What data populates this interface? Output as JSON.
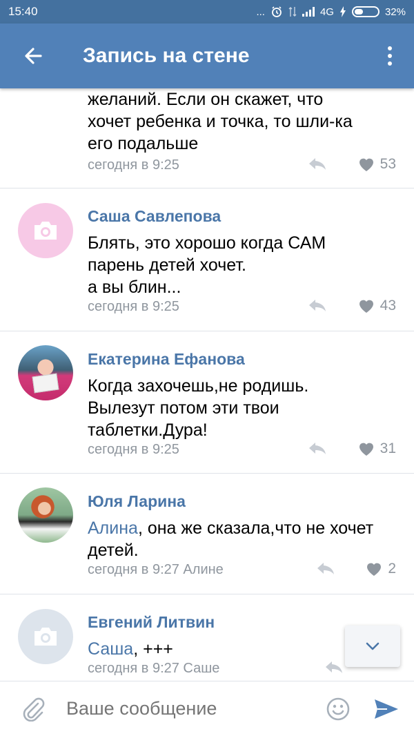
{
  "status_bar": {
    "time": "15:40",
    "dots": "...",
    "network": "4G",
    "battery": "32%"
  },
  "app_bar": {
    "title": "Запись на стене"
  },
  "comments": [
    {
      "name": "",
      "text_lines": [
        "желаний. Если он скажет, что",
        "хочет ребенка и точка, то шли-ка",
        "его подальше"
      ],
      "time": "сегодня в 9:25",
      "likes": "53"
    },
    {
      "name": "Саша Савлепова",
      "text_lines": [
        "Блять, это хорошо когда САМ",
        "парень детей хочет.",
        "а вы блин..."
      ],
      "time": "сегодня в 9:25",
      "likes": "43"
    },
    {
      "name": "Екатерина Ефанова",
      "text_lines": [
        "Когда захочешь,не родишь.",
        "Вылезут потом эти твои",
        "таблетки.Дура!"
      ],
      "time": "сегодня в 9:25",
      "likes": "31"
    },
    {
      "name": "Юля Ларина",
      "mention": "Алина",
      "text_rest": ", она же сказала,что не хочет",
      "text_line2": "детей.",
      "time": "сегодня в 9:27 Алине",
      "likes": "2"
    },
    {
      "name": "Евгений Литвин",
      "mention": "Саша",
      "text_rest": ", +++",
      "time": "сегодня в 9:27 Саше"
    }
  ],
  "composer": {
    "placeholder": "Ваше сообщение"
  },
  "colors": {
    "status_bar": "#44719f",
    "app_bar": "#5181b8",
    "link": "#4a76a8",
    "meta": "#8f969e"
  }
}
